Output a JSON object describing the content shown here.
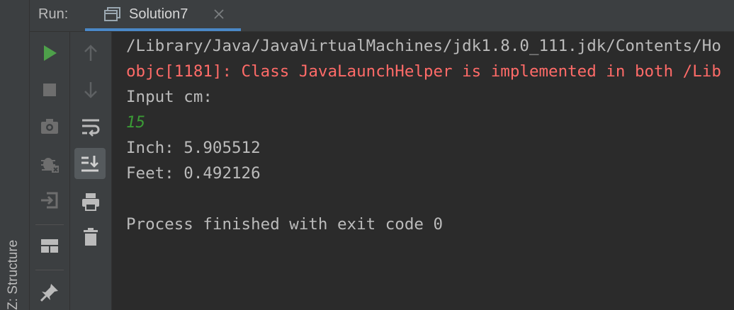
{
  "side_panel": {
    "label": "Z: Structure"
  },
  "header": {
    "run_label": "Run:",
    "tab": {
      "title": "Solution7",
      "icon": "console-window-icon",
      "close_icon": "close-icon"
    }
  },
  "toolbar_left": [
    "run-icon",
    "stop-icon",
    "camera-icon",
    "debug-bug-icon",
    "exit-icon",
    "layout-icon",
    "pin-icon"
  ],
  "toolbar_right": [
    "arrow-up-icon",
    "arrow-down-icon",
    "soft-wrap-icon",
    "scroll-to-end-icon",
    "print-icon",
    "trash-icon"
  ],
  "console": {
    "lines": [
      {
        "text": "/Library/Java/JavaVirtualMachines/jdk1.8.0_111.jdk/Contents/Ho",
        "type": "normal"
      },
      {
        "text": "objc[1181]: Class JavaLaunchHelper is implemented in both /Lib",
        "type": "error"
      },
      {
        "text": "Input cm:",
        "type": "normal"
      },
      {
        "text": "15",
        "type": "input"
      },
      {
        "text": "Inch: 5.905512",
        "type": "normal"
      },
      {
        "text": "Feet: 0.492126",
        "type": "normal"
      },
      {
        "text": "",
        "type": "normal"
      },
      {
        "text": "Process finished with exit code 0",
        "type": "normal"
      }
    ]
  },
  "colors": {
    "background": "#2b2b2b",
    "panel": "#3c3f41",
    "text": "#bbbbbb",
    "error": "#ff6b68",
    "user_input": "#3b9b36",
    "run_green": "#4ea04a",
    "tab_underline": "#4a88c7"
  }
}
